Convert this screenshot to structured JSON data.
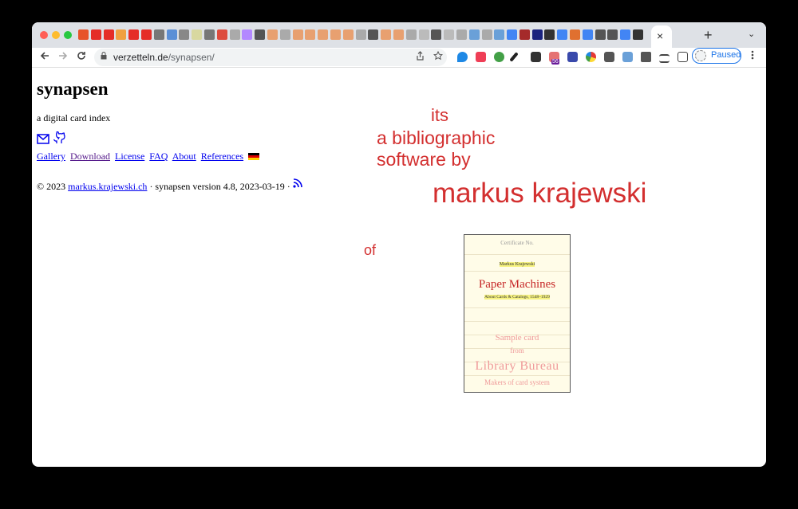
{
  "browser": {
    "active_tab_close": "×",
    "new_tab": "+",
    "tab_list": "⌄",
    "url_host": "verzetteln.de",
    "url_path": "/synapsen/",
    "profile_status": "Paused",
    "extension_badge": "56",
    "tab_favicon_colors": [
      "#e7532a",
      "#e52d27",
      "#e52d27",
      "#f0a040",
      "#e52d27",
      "#e52d27",
      "#777777",
      "#5b8fd6",
      "#888888",
      "#d8d8a0",
      "#777777",
      "#dd4b3e",
      "#aaaaaa",
      "#b388ff",
      "#555555",
      "#e8a070",
      "#aaaaaa",
      "#e8a070",
      "#e8a070",
      "#e8a070",
      "#e8a070",
      "#e8a070",
      "#aaaaaa",
      "#555555",
      "#e8a070",
      "#e8a070",
      "#aaaaaa",
      "#bbbbbb",
      "#555555",
      "#bbbbbb",
      "#aaaaaa",
      "#6aa0d8",
      "#aaaaaa",
      "#6aa0d8",
      "#4285f4",
      "#a52a2a",
      "#1a237e",
      "#333333",
      "#4285f4",
      "#e07030",
      "#4285f4",
      "#555555",
      "#555555",
      "#4285f4",
      "#333333"
    ]
  },
  "page": {
    "title": "synapsen",
    "subtitle": "a digital card index",
    "links": [
      "Gallery",
      "Download",
      "License",
      "FAQ",
      "About",
      "References"
    ],
    "footer_prefix": "© 2023",
    "footer_link": "markus.krajewski.ch",
    "footer_suffix": "· synapsen version 4.8, 2023-03-19 ·"
  },
  "promo": {
    "its": "its",
    "line1": "a bibliographic",
    "line2": "software by",
    "author": "markus krajewski",
    "of": "of",
    "accent_color": "#d32f2f"
  },
  "card": {
    "certificate": "Certificate No.",
    "name": "Markus Krajewski",
    "title": "Paper Machines",
    "subtitle": "About Cards & Catalogs, 1548–1929",
    "stamp1": "Sample card",
    "stamp2": "from",
    "stamp3": "Library Bureau",
    "stamp4": "Makers of card system"
  }
}
